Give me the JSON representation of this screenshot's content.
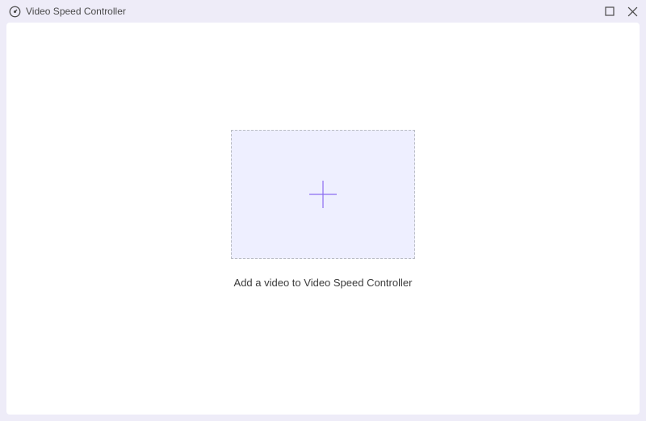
{
  "header": {
    "title": "Video Speed Controller"
  },
  "main": {
    "instruction": "Add a video to Video Speed Controller"
  },
  "icons": {
    "app": "speedometer-icon",
    "maximize": "maximize-icon",
    "close": "close-icon",
    "plus": "plus-icon"
  }
}
